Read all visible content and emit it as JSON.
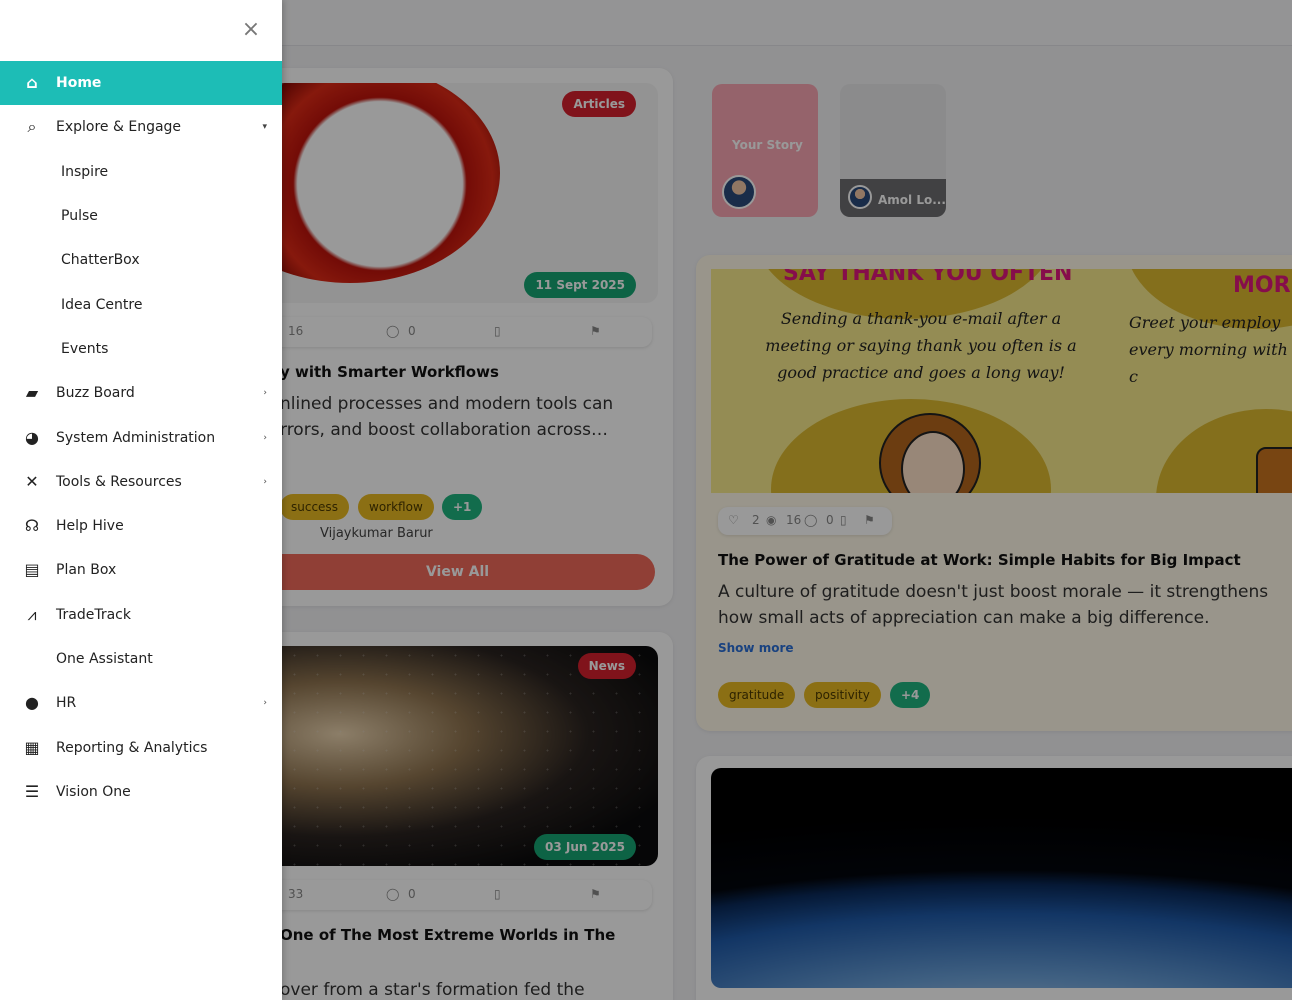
{
  "sidebar": {
    "items": [
      {
        "label": "Home",
        "icon": "home-icon",
        "active": true
      },
      {
        "label": "Explore & Engage",
        "icon": "search-icon",
        "chevron": "down"
      },
      {
        "label": "Inspire",
        "sub": true
      },
      {
        "label": "Pulse",
        "sub": true
      },
      {
        "label": "ChatterBox",
        "sub": true
      },
      {
        "label": "Idea Centre",
        "sub": true
      },
      {
        "label": "Events",
        "sub": true
      },
      {
        "label": "Buzz Board",
        "icon": "chat-bubbles-icon",
        "chevron": "right"
      },
      {
        "label": "System Administration",
        "icon": "globe-icon",
        "chevron": "right"
      },
      {
        "label": "Tools & Resources",
        "icon": "tools-icon",
        "chevron": "right"
      },
      {
        "label": "Help Hive",
        "icon": "headset-icon"
      },
      {
        "label": "Plan Box",
        "icon": "clipboard-icon"
      },
      {
        "label": "TradeTrack",
        "icon": "trending-chart-icon"
      },
      {
        "label": "One Assistant",
        "icon": ""
      },
      {
        "label": "HR",
        "icon": "person-icon",
        "chevron": "right"
      },
      {
        "label": "Reporting & Analytics",
        "icon": "document-icon"
      },
      {
        "label": "Vision One",
        "icon": "checklist-icon"
      }
    ]
  },
  "feed": {
    "card1": {
      "category": "Articles",
      "date": "11 Sept 2025",
      "views": "16",
      "comments": "0",
      "title": "y with Smarter Workflows",
      "desc": "nlined processes and modern tools can rrors, and boost collaboration across…",
      "tags": [
        "success",
        "workflow",
        "+1"
      ],
      "author": "Vijaykumar Barur",
      "view_all": "View All"
    },
    "card2": {
      "category": "News",
      "date": "03 Jun 2025",
      "views": "33",
      "comments": "0",
      "title": "One of The Most Extreme Worlds in The",
      "desc": "over from a star's formation fed the"
    },
    "stories": {
      "your_story": "Your Story",
      "other_name": "Amol Lo..."
    },
    "post": {
      "poster_heading_left": "SAY THANK YOU OFTEN",
      "poster_heading_right": "MOR",
      "poster_text_left": "Sending a thank-you e-mail after a meeting or saying thank you often is a good practice and goes a long way!",
      "poster_text_right": "Greet your employ every morning with they c",
      "likes": "2",
      "views": "16",
      "comments": "0",
      "title": "The Power of Gratitude at Work: Simple Habits for Big Impact",
      "desc": "A culture of gratitude doesn't just boost morale — it strengthens how small acts of appreciation can make a big difference.",
      "show_more": "Show more",
      "tags": [
        "gratitude",
        "positivity",
        "+4"
      ]
    }
  },
  "colors": {
    "accent": "#1dbdb6",
    "article_badge": "#d6202e",
    "date_badge": "#17a673",
    "tag_yellow": "#e8b922",
    "tag_green": "#1eb47f"
  }
}
